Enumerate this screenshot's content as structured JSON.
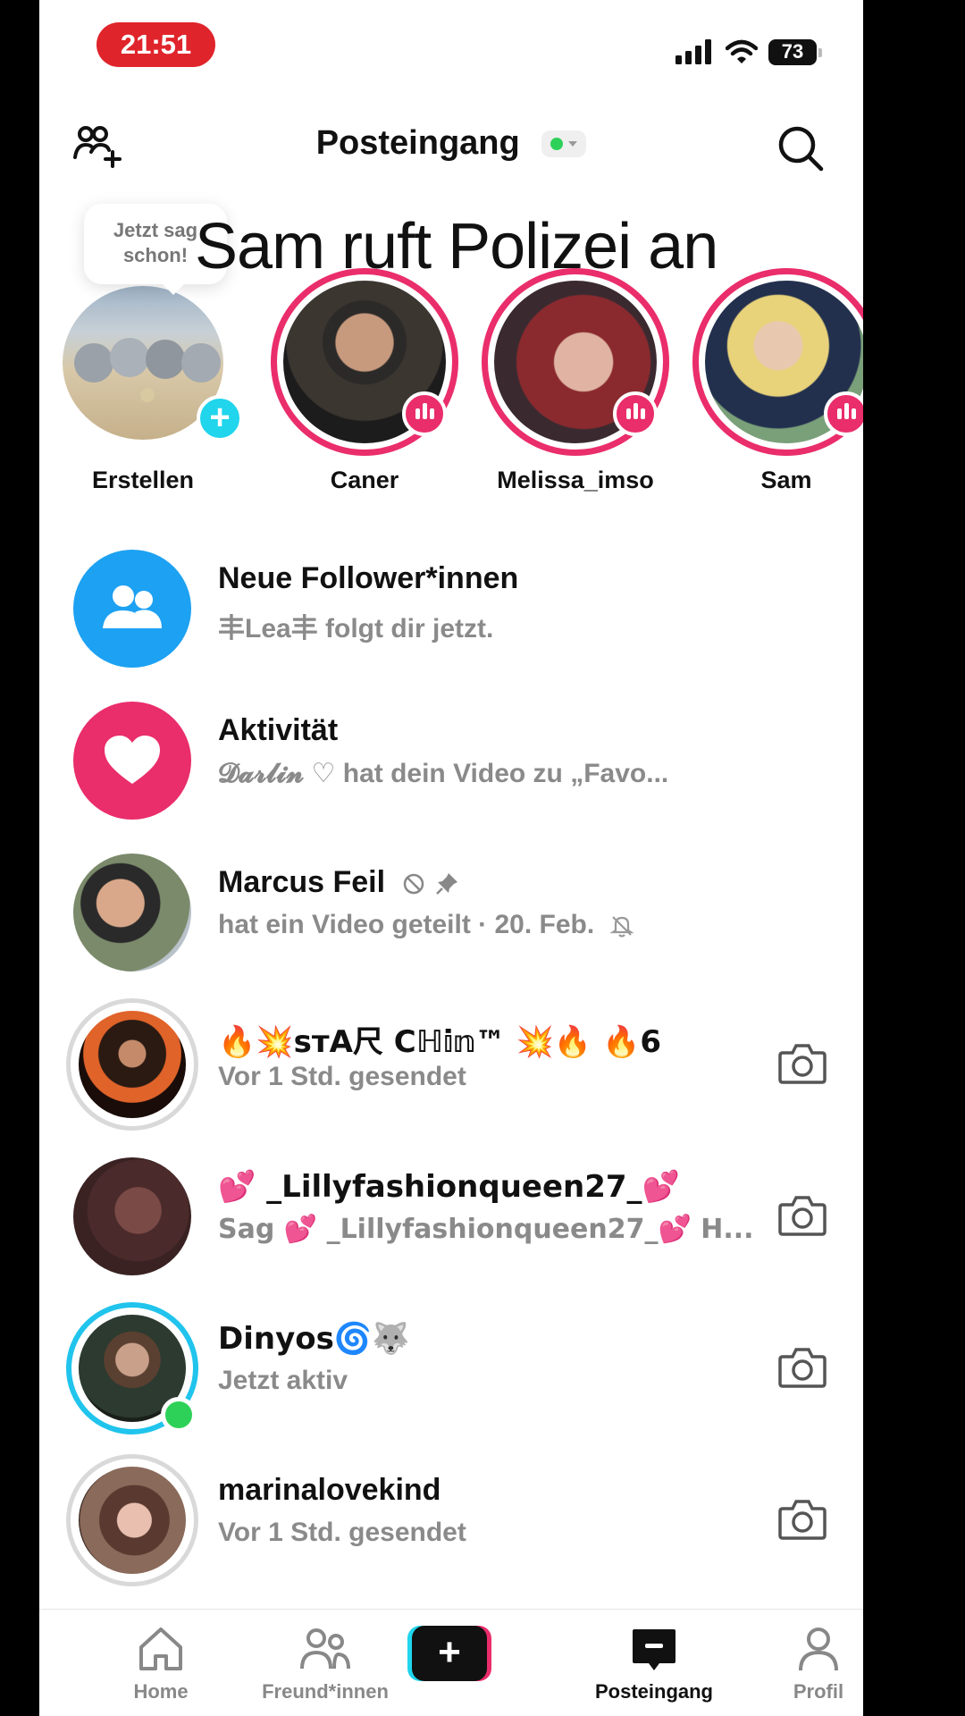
{
  "status_bar": {
    "time": "21:51",
    "battery": "73"
  },
  "header": {
    "title": "Posteingang"
  },
  "overlay": {
    "caption": "Sam ruft Polizei an"
  },
  "stories": {
    "tooltip": "Jetzt sag schon!",
    "items": [
      {
        "name": "Erstellen"
      },
      {
        "name": "Caner"
      },
      {
        "name": "Melissa_imso"
      },
      {
        "name": "Sam"
      }
    ]
  },
  "inbox": [
    {
      "title": "Neue Follower*innen",
      "subtitle": "丰Lea丰 folgt dir jetzt."
    },
    {
      "title": "Aktivität",
      "subtitle": "𝓓𝓪𝓻𝓵𝓲𝓷 ♡ hat dein Video zu „Favo..."
    },
    {
      "title": "Marcus Feil",
      "subtitle": "hat ein Video geteilt · 20. Feb."
    },
    {
      "title": "🔥💥ѕтΑ尺 Cℍ𝕚𝕟™ 💥🔥 🔥6",
      "subtitle": "Vor 1 Std. gesendet"
    },
    {
      "title": "💕 _Lillyfashionqueen27_💕",
      "subtitle": "Sag 💕 _Lillyfashionqueen27_💕 H..."
    },
    {
      "title": "Dinyos🌀🐺",
      "subtitle": "Jetzt aktiv"
    },
    {
      "title": "marinalovekind",
      "subtitle": "Vor 1 Std. gesendet"
    }
  ],
  "tabbar": {
    "items": [
      {
        "label": "Home"
      },
      {
        "label": "Freund*innen"
      },
      {
        "label": "Posteingang"
      },
      {
        "label": "Profil"
      }
    ]
  },
  "colors": {
    "accent_pink": "#ea2d6b",
    "accent_cyan": "#20d5ec",
    "follower_blue": "#1da1f2",
    "online_green": "#2ed158",
    "status_red": "#e0242b"
  }
}
